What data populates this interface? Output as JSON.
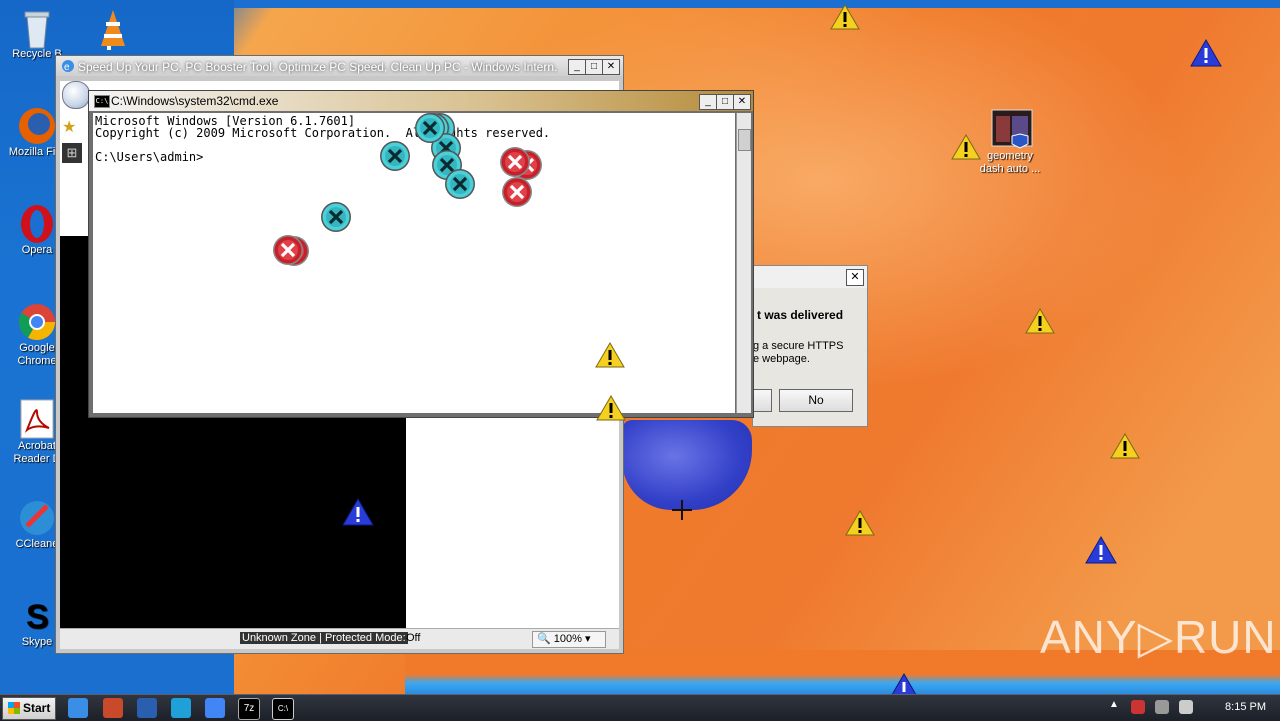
{
  "desktop": {
    "icons": [
      {
        "label": "Recycle Bin",
        "shown": "Recycle B"
      },
      {
        "label": "Mozilla Firefox",
        "shown": "Mozilla Fire"
      },
      {
        "label": "Opera",
        "shown": "Opera"
      },
      {
        "label": "Google Chrome",
        "line1": "Google",
        "line2": "Chrome"
      },
      {
        "label": "Acrobat Reader DC",
        "line1": "Acrobat",
        "line2": "Reader D"
      },
      {
        "label": "CCleaner",
        "shown": "CCleane"
      },
      {
        "label": "Skype",
        "shown": "Skype"
      },
      {
        "label": "geometry dash auto ...",
        "line1": "geometry",
        "line2": "dash auto ..."
      }
    ]
  },
  "ie_window": {
    "title": "Speed Up Your PC, PC Booster Tool, Optimize PC Speed, Clean Up PC - Windows Intern...",
    "status_zone": "Unknown Zone | Protected Mode:",
    "status_mode": "Off",
    "zoom": "100%"
  },
  "dialog": {
    "message_bold": "t was delivered",
    "message_line1": "g a secure HTTPS",
    "message_line2": "e webpage.",
    "no_label": "No",
    "close_label": "✕"
  },
  "cmd_window": {
    "title": "C:\\Windows\\system32\\cmd.exe",
    "lines": [
      "Microsoft Windows [Version 6.1.7601]",
      "Copyright (c) 2009 Microsoft Corporation.  All rights reserved.",
      "",
      "C:\\Users\\admin>"
    ]
  },
  "taskbar": {
    "start_label": "Start",
    "clock": "8:15 PM"
  },
  "watermark": "ANY▷RUN",
  "colors": {
    "desktop_orange": "#f39138",
    "desktop_blue": "#1a6fd0",
    "taskbar": "#1c2028",
    "error_red": "#c8202a",
    "teal_x": "#4ad0d8"
  }
}
